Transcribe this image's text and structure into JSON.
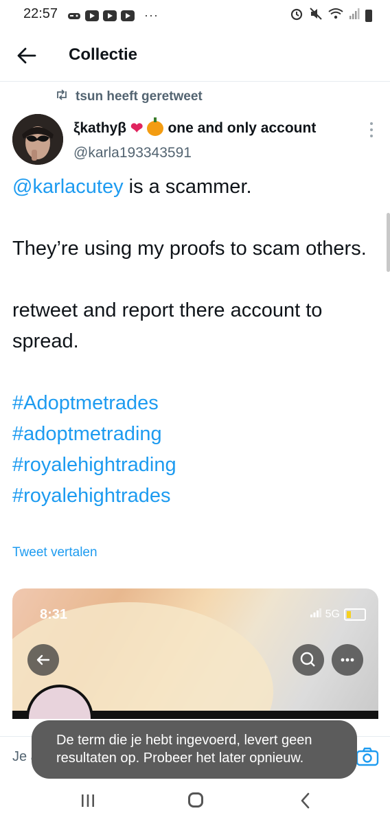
{
  "status_bar": {
    "time": "22:57",
    "overflow": "···"
  },
  "header": {
    "title": "Collectie"
  },
  "tweet": {
    "retweet_label": "tsun heeft geretweet",
    "display_name": "ξkathyβ",
    "display_name_suffix": "one and only account",
    "handle": "@karla193343591",
    "mention": "@karlacutey",
    "line1_rest": " is a scammer.",
    "line2": "They’re using my proofs to scam others.",
    "line3": "retweet and report there account to spread.",
    "hashtags": [
      "#Adoptmetrades",
      "#adoptmetrading",
      "#royalehightrading",
      "#royalehightrades"
    ],
    "translate_label": "Tweet vertalen"
  },
  "media": {
    "time": "8:31",
    "network": "5G"
  },
  "reply": {
    "placeholder": "Je ant"
  },
  "toast": {
    "message": "De term die je hebt ingevoerd, levert geen resultaten op. Probeer het later opnieuw."
  },
  "colors": {
    "link": "#1d9bf0",
    "muted": "#536471",
    "toast_bg": "#5c5c5c"
  }
}
